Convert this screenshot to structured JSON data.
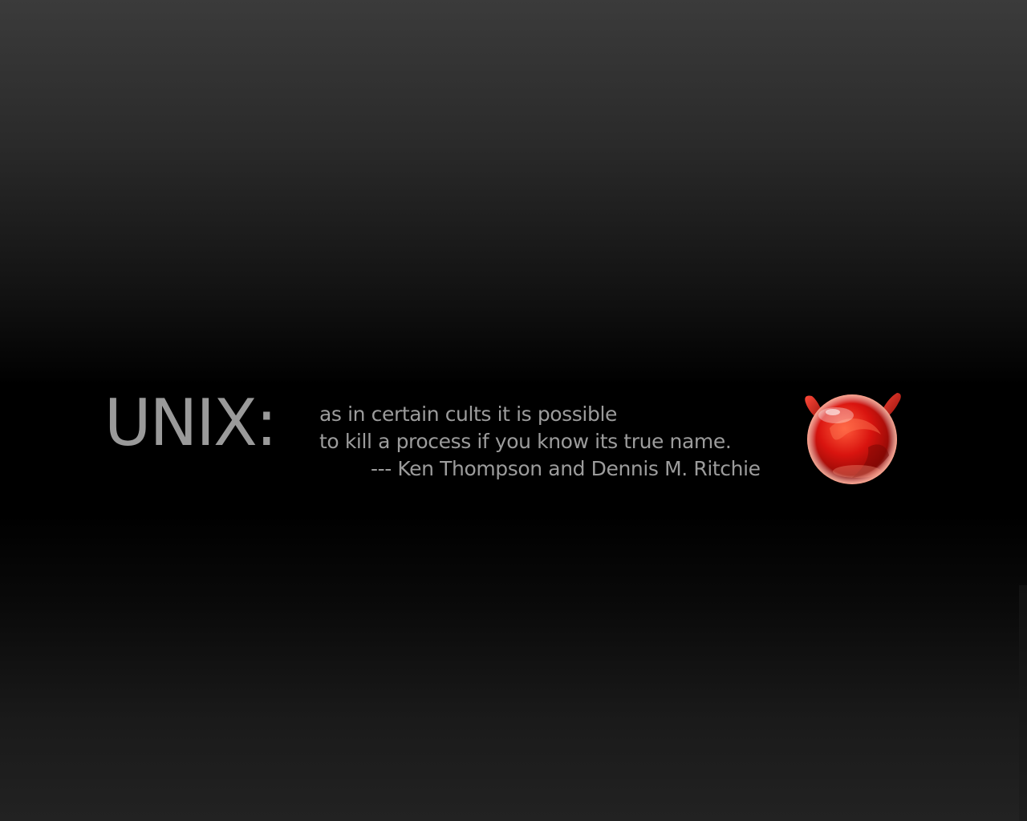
{
  "wallpaper": {
    "headline": "UNIX:",
    "quote_lines": [
      "as in certain cults it is possible",
      "to kill a process if you know its true name.",
      "--- Ken Thompson and Dennis M. Ritchie"
    ],
    "logo_icon": "bsd-daemon-head-icon",
    "colors": {
      "background_top": "#3b3b3b",
      "background_middle": "#000000",
      "background_bottom": "#222222",
      "text": "#9a9a9a",
      "logo_red": "#d9140f",
      "logo_highlight": "#ff8a70"
    }
  }
}
